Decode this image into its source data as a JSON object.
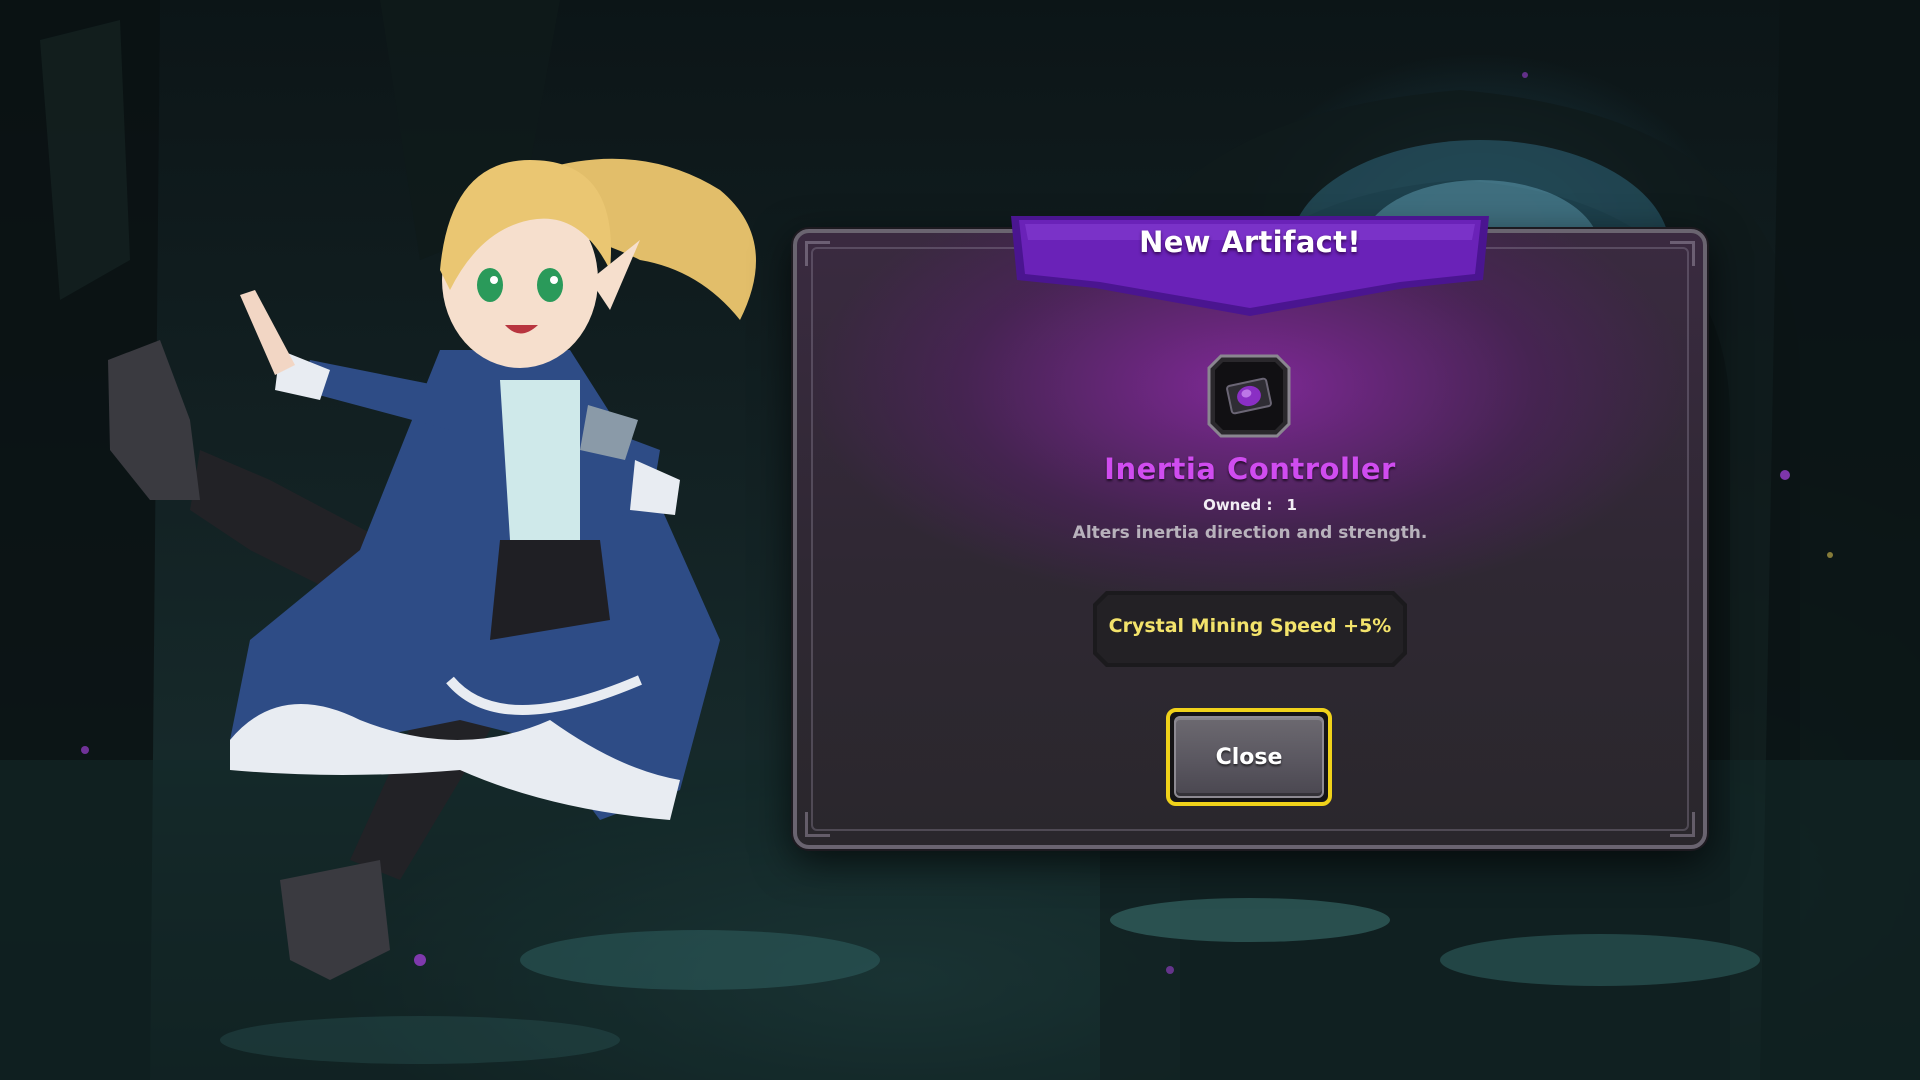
{
  "dialog": {
    "title": "New Artifact!",
    "item": {
      "name": "Inertia Controller",
      "icon": "purple-gem-chip-icon",
      "owned_label": "Owned :",
      "owned_count": "1",
      "description": "Alters inertia direction and strength.",
      "bonus": "Crystal Mining Speed +5%"
    },
    "close_label": "Close"
  },
  "colors": {
    "banner": "#6a22b8",
    "item_name": "#d04cf0",
    "bonus_text": "#f3e36b",
    "close_border": "#f0d21a"
  }
}
